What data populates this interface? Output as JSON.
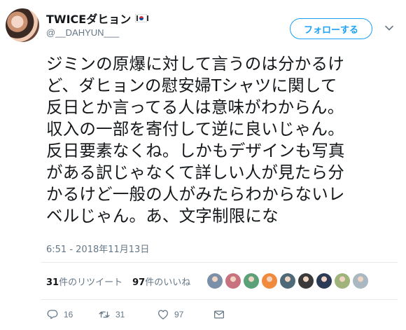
{
  "user": {
    "display_name": "TWICEダヒョン",
    "handle": "@__DAHYUN___",
    "flag_icon": "south-korea-flag-icon"
  },
  "follow_button": {
    "label": "フォローする"
  },
  "tweet": {
    "lines": [
      "ジミンの原爆に対して言うのは分かるけ",
      "ど、ダヒョンの慰安婦Tシャツに関して",
      "反日とか言ってる人は意味がわからん。",
      "収入の一部を寄付して逆に良いじゃん。",
      "反日要素なくね。しかもデザインも写真",
      "がある訳じゃなくて詳しい人が見たら分",
      "かるけど一般の人がみたらわからないレ",
      "ベルじゃん。あ、文字制限にな"
    ],
    "timestamp": "6:51 - 2018年11月13日"
  },
  "stats": {
    "retweets_count": "31",
    "retweets_label": "件のリツイート",
    "likes_count": "97",
    "likes_label": "件のいいね"
  },
  "likers": {
    "avatar_colors": [
      "#7b8fa8",
      "#c9727f",
      "#5aa17a",
      "#f08a3c",
      "#4e6a78",
      "#3a3a3a",
      "#2b3a55",
      "#9fb37a",
      "#aab8c2"
    ]
  },
  "actions": {
    "reply_count": "16",
    "retweet_count": "31",
    "like_count": "97"
  },
  "colors": {
    "accent": "#1da1f2",
    "muted": "#657786",
    "text": "#14171a"
  }
}
